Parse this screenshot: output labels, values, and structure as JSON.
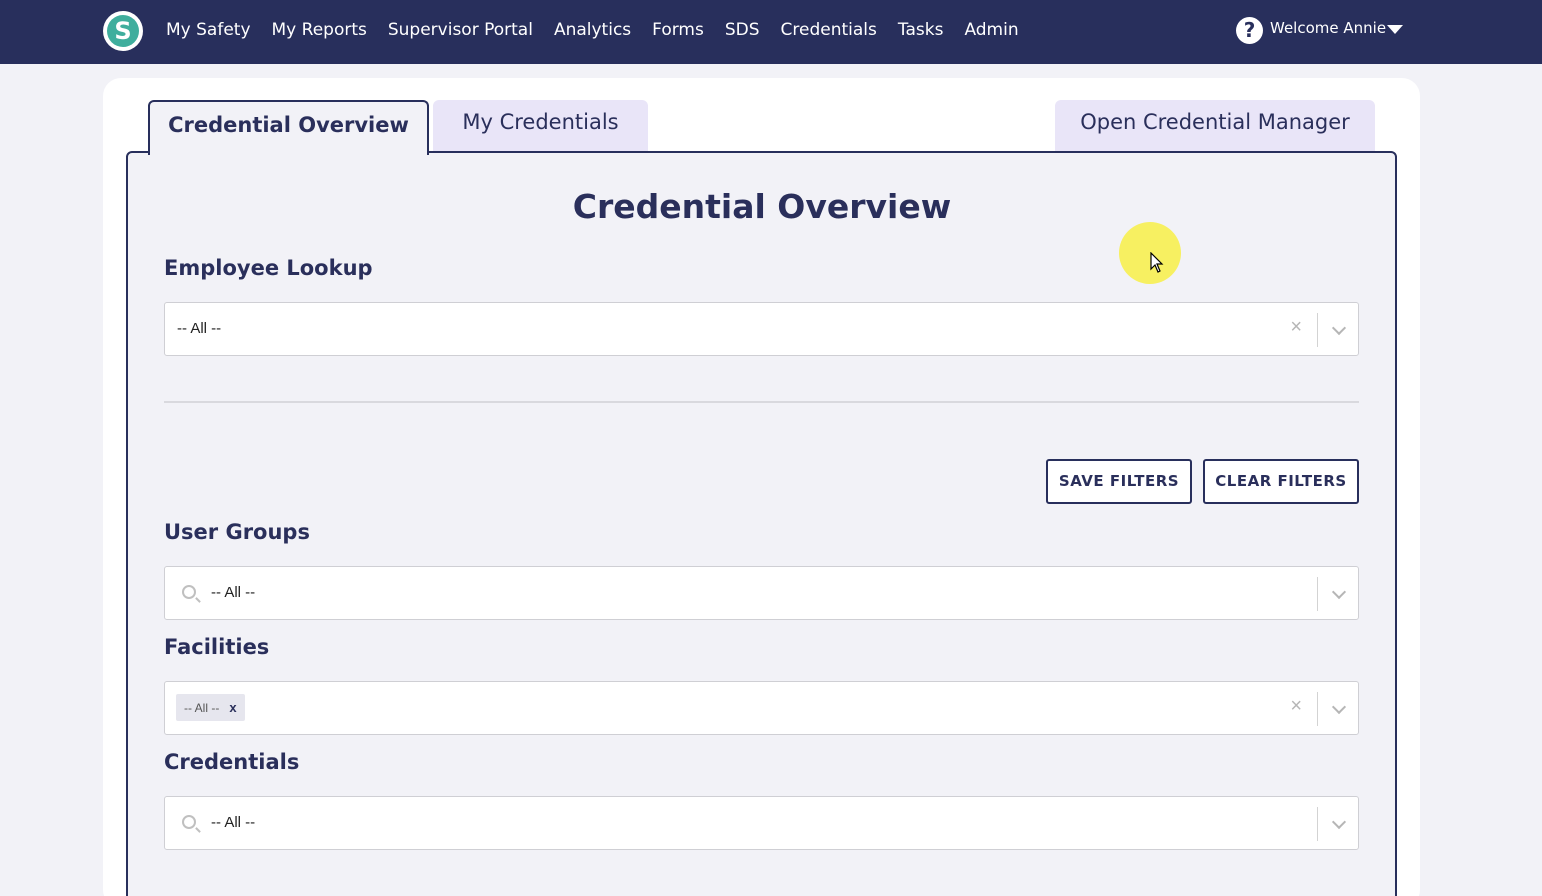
{
  "nav": {
    "logo_letter": "S",
    "links": [
      "My Safety",
      "My Reports",
      "Supervisor Portal",
      "Analytics",
      "Forms",
      "SDS",
      "Credentials",
      "Tasks",
      "Admin"
    ],
    "help_symbol": "?",
    "welcome": "Welcome Annie"
  },
  "tabs": {
    "overview": "Credential Overview",
    "my_credentials": "My Credentials",
    "manager": "Open Credential Manager"
  },
  "main": {
    "title": "Credential Overview",
    "employee_lookup": {
      "label": "Employee Lookup",
      "value": "-- All --",
      "clear_symbol": "×"
    },
    "buttons": {
      "save": "SAVE FILTERS",
      "clear": "CLEAR FILTERS"
    },
    "user_groups": {
      "label": "User Groups",
      "value": "-- All --"
    },
    "facilities": {
      "label": "Facilities",
      "chip": "-- All --",
      "chip_remove": "x",
      "clear_symbol": "×"
    },
    "credentials": {
      "label": "Credentials",
      "value": "-- All --"
    }
  },
  "colors": {
    "nav_bg": "#282f5c",
    "accent": "#2a2f5b",
    "tab_bg": "#e9e5f8",
    "logo": "#3fae9d"
  }
}
